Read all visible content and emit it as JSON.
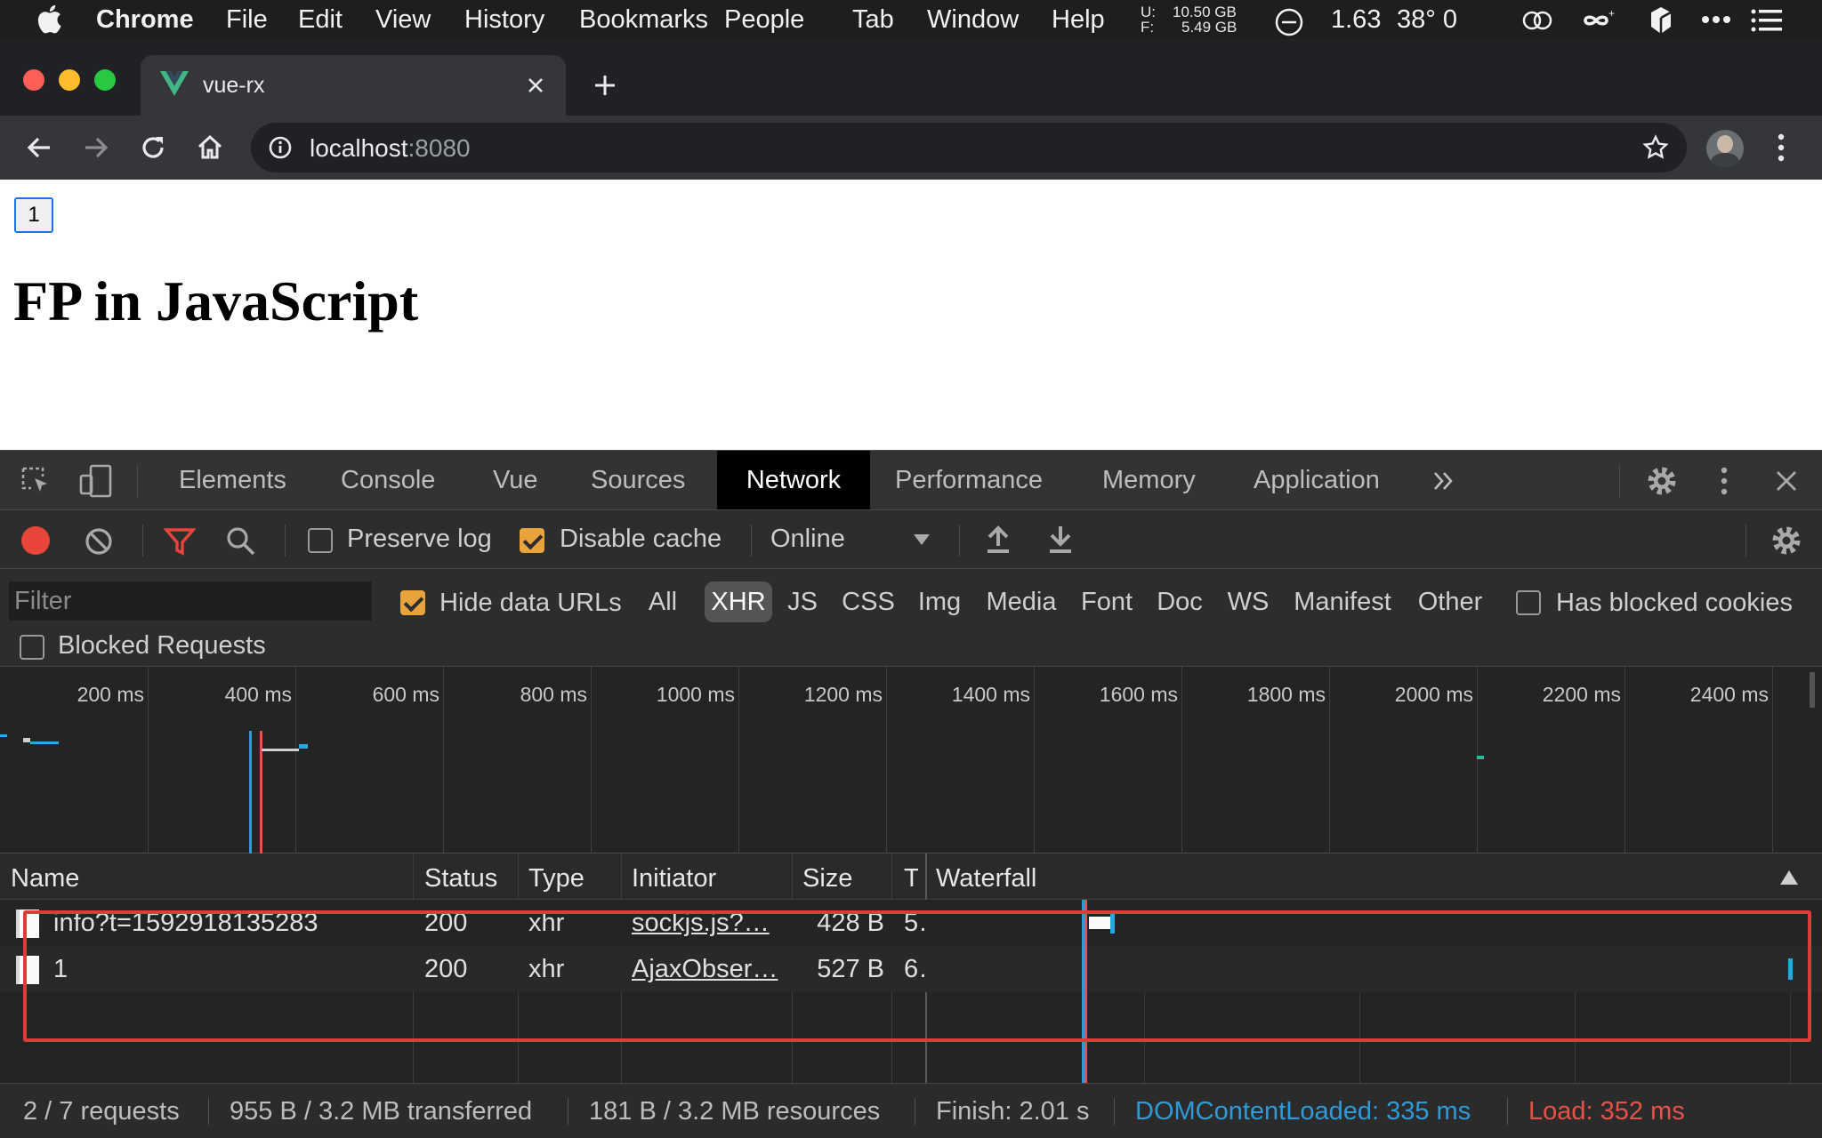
{
  "menubar": {
    "app": "Chrome",
    "items": [
      "File",
      "Edit",
      "View",
      "History",
      "Bookmarks",
      "People",
      "Tab",
      "Window",
      "Help"
    ],
    "disk_u_label": "U:",
    "disk_f_label": "F:",
    "disk_u": "10.50 GB",
    "disk_f": "5.49 GB",
    "load": "1.63",
    "temp": "38° 0"
  },
  "browser": {
    "tab_title": "vue-rx",
    "url_host": "localhost",
    "url_port": ":8080"
  },
  "page": {
    "button_label": "1",
    "heading": "FP in JavaScript"
  },
  "devtools": {
    "tabs": [
      "Elements",
      "Console",
      "Vue",
      "Sources",
      "Network",
      "Performance",
      "Memory",
      "Application"
    ],
    "active_tab": "Network",
    "toolbar": {
      "preserve_log": "Preserve log",
      "preserve_log_checked": false,
      "disable_cache": "Disable cache",
      "disable_cache_checked": true,
      "throttle": "Online"
    },
    "filterbar": {
      "filter_placeholder": "Filter",
      "hide_data_urls": "Hide data URLs",
      "hide_data_urls_checked": true,
      "types": [
        "All",
        "XHR",
        "JS",
        "CSS",
        "Img",
        "Media",
        "Font",
        "Doc",
        "WS",
        "Manifest",
        "Other"
      ],
      "active_type": "XHR",
      "has_blocked_cookies": "Has blocked cookies",
      "has_blocked_cookies_checked": false,
      "blocked_requests": "Blocked Requests",
      "blocked_requests_checked": false
    },
    "overview": {
      "ticks": [
        "200 ms",
        "400 ms",
        "600 ms",
        "800 ms",
        "1000 ms",
        "1200 ms",
        "1400 ms",
        "1600 ms",
        "1800 ms",
        "2000 ms",
        "2200 ms",
        "2400 ms"
      ]
    },
    "table": {
      "columns": [
        "Name",
        "Status",
        "Type",
        "Initiator",
        "Size",
        "T",
        "Waterfall"
      ],
      "rows": [
        {
          "name": "info?t=1592918135283",
          "status": "200",
          "type": "xhr",
          "initiator": "sockjs.js?…",
          "size": "428 B",
          "time": "5."
        },
        {
          "name": "1",
          "status": "200",
          "type": "xhr",
          "initiator": "AjaxObser…",
          "size": "527 B",
          "time": "6."
        }
      ]
    },
    "status": {
      "requests": "2 / 7 requests",
      "transferred": "955 B / 3.2 MB transferred",
      "resources": "181 B / 3.2 MB resources",
      "finish": "Finish: 2.01 s",
      "dom_content_loaded": "DOMContentLoaded: 335 ms",
      "load": "Load: 352 ms"
    }
  },
  "colors": {
    "dcl_blue": "#2f9bd6",
    "load_red": "#e8514a",
    "highlight_red": "#e03b3b",
    "record_red": "#e8453c",
    "checkbox_orange": "#e8a33d"
  }
}
